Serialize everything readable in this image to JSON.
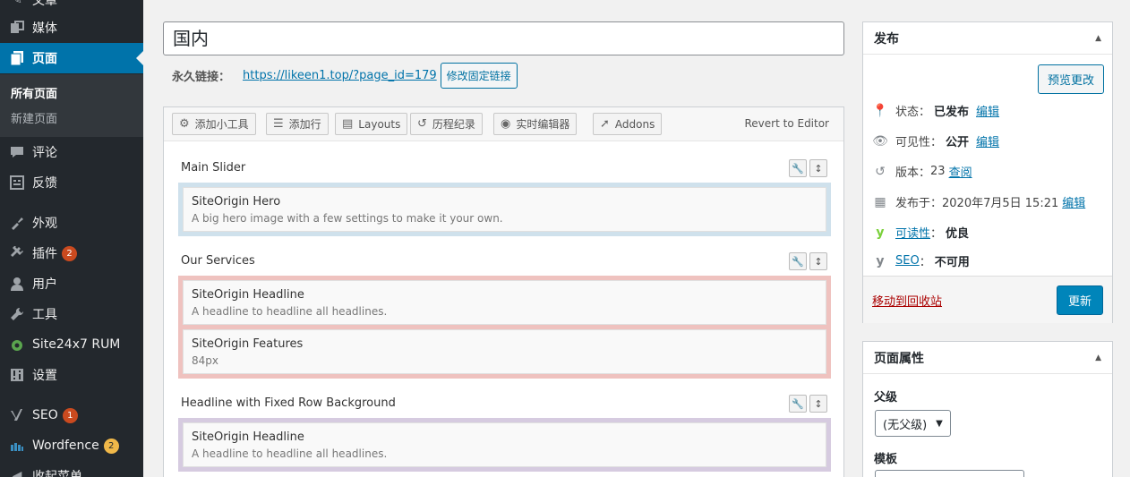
{
  "sidebar": {
    "top_partial": "文章",
    "items": [
      {
        "label": "媒体",
        "icon": "media-icon"
      },
      {
        "label": "页面",
        "icon": "page-icon"
      },
      {
        "label": "评论",
        "icon": "comment-icon"
      },
      {
        "label": "反馈",
        "icon": "feedback-icon"
      },
      {
        "label": "外观",
        "icon": "appearance-icon"
      },
      {
        "label": "插件",
        "icon": "plugin-icon",
        "badge": "2"
      },
      {
        "label": "用户",
        "icon": "user-icon"
      },
      {
        "label": "工具",
        "icon": "tools-icon"
      },
      {
        "label": "Site24x7 RUM",
        "icon": "site24x7-icon"
      },
      {
        "label": "设置",
        "icon": "settings-icon"
      },
      {
        "label": "SEO",
        "icon": "yoast-icon",
        "badge": "1"
      },
      {
        "label": "Wordfence",
        "icon": "wordfence-icon",
        "badge": "2"
      },
      {
        "label": "收起菜单",
        "icon": "collapse-icon"
      }
    ],
    "submenu": [
      "所有页面",
      "新建页面"
    ]
  },
  "title": "国内",
  "permalink": {
    "label": "永久链接：",
    "url": "https://likeen1.top/?page_id=179",
    "edit_button": "修改固定链接"
  },
  "builder": {
    "toolbar": {
      "add_widget": "添加小工具",
      "add_row": "添加行",
      "layouts": "Layouts",
      "history": "历程纪录",
      "live_editor": "实时编辑器",
      "addons": "Addons",
      "revert": "Revert to Editor"
    },
    "rows": [
      {
        "title": "Main Slider",
        "color": "#cfe1ec",
        "widgets": [
          {
            "title": "SiteOrigin Hero",
            "desc": "A big hero image with a few settings to make it your own."
          }
        ]
      },
      {
        "title": "Our Services",
        "color": "#efc2bf",
        "widgets": [
          {
            "title": "SiteOrigin Headline",
            "desc": "A headline to headline all headlines."
          },
          {
            "title": "SiteOrigin Features",
            "desc": "84px"
          }
        ]
      },
      {
        "title": "Headline with Fixed Row Background",
        "color": "#d6cbe0",
        "widgets": [
          {
            "title": "SiteOrigin Headline",
            "desc": "A headline to headline all headlines."
          }
        ]
      }
    ]
  },
  "publish": {
    "title": "发布",
    "preview_button": "预览更改",
    "status_label": "状态：",
    "status_value": "已发布",
    "visibility_label": "可见性：",
    "visibility_value": "公开",
    "revisions_label": "版本：",
    "revisions_value": "23",
    "revisions_link": "查阅",
    "published_label": "发布于：",
    "published_value": "2020年7月5日 15:21",
    "edit_link": "编辑",
    "readability_label": "可读性",
    "readability_value": "优良",
    "seo_label": "SEO",
    "seo_value": "不可用",
    "trash_link": "移动到回收站",
    "update_button": "更新"
  },
  "page_attributes": {
    "title": "页面属性",
    "parent_label": "父级",
    "parent_value": "(无父级)",
    "template_label": "模板"
  },
  "colors": {
    "accent": "#0073aa",
    "sidebar_bg": "#23282d",
    "badge": "#ca4a1f",
    "yoast_green": "#7ad03a"
  }
}
